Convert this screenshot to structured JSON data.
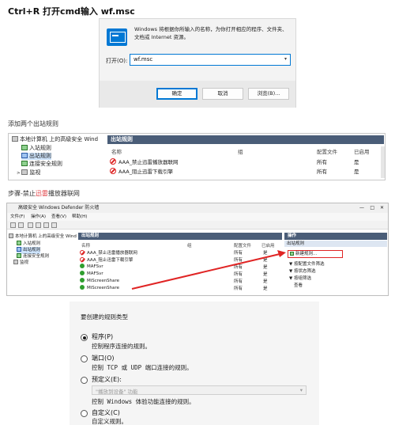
{
  "step1": {
    "heading": "Ctrl+R 打开cmd输入   wf.msc"
  },
  "run_dialog": {
    "message": "Windows 将根据你所输入的名称，为你打开相应的程序、文件夹、文档或 Internet 资源。",
    "open_label": "打开(O):",
    "input_value": "wf.msc",
    "ok": "确定",
    "cancel": "取消",
    "browse": "浏览(B)..."
  },
  "step2": {
    "caption": "添加两个出站规则"
  },
  "firewall_1": {
    "tree": {
      "root": "本地计算机 上的高级安全 Wind",
      "inbound": "入站规则",
      "outbound": "出站规则",
      "connection": "连接安全规则",
      "monitor": "监视"
    },
    "panel_title": "出站规则",
    "columns": [
      "名称",
      "组",
      "配置文件",
      "已启用"
    ],
    "rows": [
      {
        "name": "AAA_禁止迅雷播放器联网",
        "group": "",
        "profile": "所有",
        "enabled": "是"
      },
      {
        "name": "AAA_阻止迅雷下载引擎",
        "group": "",
        "profile": "所有",
        "enabled": "是"
      }
    ]
  },
  "step3": {
    "caption": "步骤-禁止迅雷播放器联网",
    "highlight": "迅雷"
  },
  "firewall_2": {
    "title": "高级安全 Windows Defender 防火墙",
    "menu": [
      "文件(F)",
      "操作(A)",
      "查看(V)",
      "帮助(H)"
    ],
    "tree": {
      "root": "本地计算机 上的高级安全 Wind",
      "inbound": "入站规则",
      "outbound": "出站规则",
      "connection": "连接安全规则",
      "monitor": "监视"
    },
    "panel_title": "出站规则",
    "columns": [
      "名称",
      "组",
      "配置文件",
      "已启用"
    ],
    "rows": [
      {
        "name": "AAA_禁止迅雷播放器联网",
        "profile": "所有",
        "enabled": "是",
        "status": "deny"
      },
      {
        "name": "AAA_阻止迅雷下载引擎",
        "profile": "所有",
        "enabled": "是",
        "status": "deny"
      },
      {
        "name": "MAFSvr",
        "profile": "所有",
        "enabled": "是",
        "status": "allow"
      },
      {
        "name": "MAFSvr",
        "profile": "所有",
        "enabled": "是",
        "status": "allow"
      },
      {
        "name": "MiScreenShare",
        "profile": "所有",
        "enabled": "是",
        "status": "allow"
      },
      {
        "name": "MiScreenShare",
        "profile": "所有",
        "enabled": "是",
        "status": "allow"
      }
    ],
    "actions": {
      "title": "操作",
      "section": "出站规则",
      "items": [
        "新建规则...",
        "按配置文件筛选",
        "按状态筛选",
        "按组筛选",
        "查看"
      ]
    }
  },
  "rule_type": {
    "heading": "要创建的规则类型",
    "options": [
      {
        "label": "程序(P)",
        "desc": "控制程序连接的规则。"
      },
      {
        "label": "端口(O)",
        "desc": "控制 TCP 或 UDP 端口连接的规则。"
      },
      {
        "label": "预定义(E):",
        "desc": "控制 Windows 体验功能连接的规则。",
        "combo": "\"播放到设备\" 功能"
      },
      {
        "label": "自定义(C)",
        "desc": "自定义规则。"
      }
    ]
  }
}
